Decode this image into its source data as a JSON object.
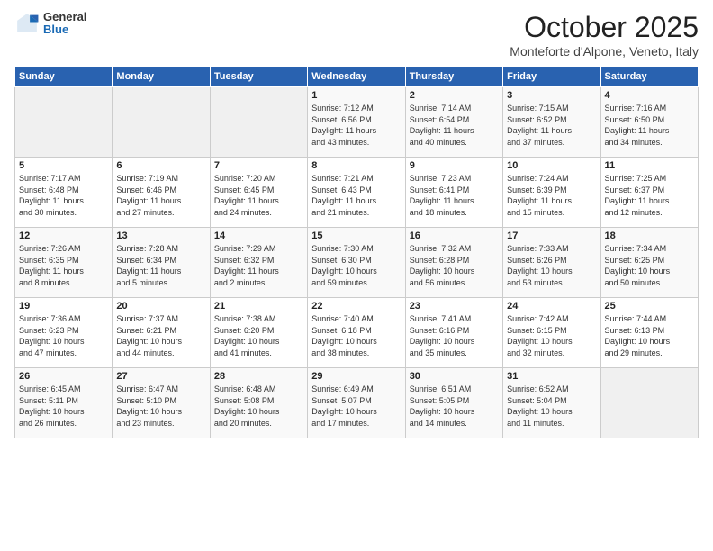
{
  "logo": {
    "general": "General",
    "blue": "Blue"
  },
  "header": {
    "title": "October 2025",
    "subtitle": "Monteforte d'Alpone, Veneto, Italy"
  },
  "days_of_week": [
    "Sunday",
    "Monday",
    "Tuesday",
    "Wednesday",
    "Thursday",
    "Friday",
    "Saturday"
  ],
  "weeks": [
    [
      {
        "day": "",
        "info": ""
      },
      {
        "day": "",
        "info": ""
      },
      {
        "day": "",
        "info": ""
      },
      {
        "day": "1",
        "info": "Sunrise: 7:12 AM\nSunset: 6:56 PM\nDaylight: 11 hours\nand 43 minutes."
      },
      {
        "day": "2",
        "info": "Sunrise: 7:14 AM\nSunset: 6:54 PM\nDaylight: 11 hours\nand 40 minutes."
      },
      {
        "day": "3",
        "info": "Sunrise: 7:15 AM\nSunset: 6:52 PM\nDaylight: 11 hours\nand 37 minutes."
      },
      {
        "day": "4",
        "info": "Sunrise: 7:16 AM\nSunset: 6:50 PM\nDaylight: 11 hours\nand 34 minutes."
      }
    ],
    [
      {
        "day": "5",
        "info": "Sunrise: 7:17 AM\nSunset: 6:48 PM\nDaylight: 11 hours\nand 30 minutes."
      },
      {
        "day": "6",
        "info": "Sunrise: 7:19 AM\nSunset: 6:46 PM\nDaylight: 11 hours\nand 27 minutes."
      },
      {
        "day": "7",
        "info": "Sunrise: 7:20 AM\nSunset: 6:45 PM\nDaylight: 11 hours\nand 24 minutes."
      },
      {
        "day": "8",
        "info": "Sunrise: 7:21 AM\nSunset: 6:43 PM\nDaylight: 11 hours\nand 21 minutes."
      },
      {
        "day": "9",
        "info": "Sunrise: 7:23 AM\nSunset: 6:41 PM\nDaylight: 11 hours\nand 18 minutes."
      },
      {
        "day": "10",
        "info": "Sunrise: 7:24 AM\nSunset: 6:39 PM\nDaylight: 11 hours\nand 15 minutes."
      },
      {
        "day": "11",
        "info": "Sunrise: 7:25 AM\nSunset: 6:37 PM\nDaylight: 11 hours\nand 12 minutes."
      }
    ],
    [
      {
        "day": "12",
        "info": "Sunrise: 7:26 AM\nSunset: 6:35 PM\nDaylight: 11 hours\nand 8 minutes."
      },
      {
        "day": "13",
        "info": "Sunrise: 7:28 AM\nSunset: 6:34 PM\nDaylight: 11 hours\nand 5 minutes."
      },
      {
        "day": "14",
        "info": "Sunrise: 7:29 AM\nSunset: 6:32 PM\nDaylight: 11 hours\nand 2 minutes."
      },
      {
        "day": "15",
        "info": "Sunrise: 7:30 AM\nSunset: 6:30 PM\nDaylight: 10 hours\nand 59 minutes."
      },
      {
        "day": "16",
        "info": "Sunrise: 7:32 AM\nSunset: 6:28 PM\nDaylight: 10 hours\nand 56 minutes."
      },
      {
        "day": "17",
        "info": "Sunrise: 7:33 AM\nSunset: 6:26 PM\nDaylight: 10 hours\nand 53 minutes."
      },
      {
        "day": "18",
        "info": "Sunrise: 7:34 AM\nSunset: 6:25 PM\nDaylight: 10 hours\nand 50 minutes."
      }
    ],
    [
      {
        "day": "19",
        "info": "Sunrise: 7:36 AM\nSunset: 6:23 PM\nDaylight: 10 hours\nand 47 minutes."
      },
      {
        "day": "20",
        "info": "Sunrise: 7:37 AM\nSunset: 6:21 PM\nDaylight: 10 hours\nand 44 minutes."
      },
      {
        "day": "21",
        "info": "Sunrise: 7:38 AM\nSunset: 6:20 PM\nDaylight: 10 hours\nand 41 minutes."
      },
      {
        "day": "22",
        "info": "Sunrise: 7:40 AM\nSunset: 6:18 PM\nDaylight: 10 hours\nand 38 minutes."
      },
      {
        "day": "23",
        "info": "Sunrise: 7:41 AM\nSunset: 6:16 PM\nDaylight: 10 hours\nand 35 minutes."
      },
      {
        "day": "24",
        "info": "Sunrise: 7:42 AM\nSunset: 6:15 PM\nDaylight: 10 hours\nand 32 minutes."
      },
      {
        "day": "25",
        "info": "Sunrise: 7:44 AM\nSunset: 6:13 PM\nDaylight: 10 hours\nand 29 minutes."
      }
    ],
    [
      {
        "day": "26",
        "info": "Sunrise: 6:45 AM\nSunset: 5:11 PM\nDaylight: 10 hours\nand 26 minutes."
      },
      {
        "day": "27",
        "info": "Sunrise: 6:47 AM\nSunset: 5:10 PM\nDaylight: 10 hours\nand 23 minutes."
      },
      {
        "day": "28",
        "info": "Sunrise: 6:48 AM\nSunset: 5:08 PM\nDaylight: 10 hours\nand 20 minutes."
      },
      {
        "day": "29",
        "info": "Sunrise: 6:49 AM\nSunset: 5:07 PM\nDaylight: 10 hours\nand 17 minutes."
      },
      {
        "day": "30",
        "info": "Sunrise: 6:51 AM\nSunset: 5:05 PM\nDaylight: 10 hours\nand 14 minutes."
      },
      {
        "day": "31",
        "info": "Sunrise: 6:52 AM\nSunset: 5:04 PM\nDaylight: 10 hours\nand 11 minutes."
      },
      {
        "day": "",
        "info": ""
      }
    ]
  ]
}
